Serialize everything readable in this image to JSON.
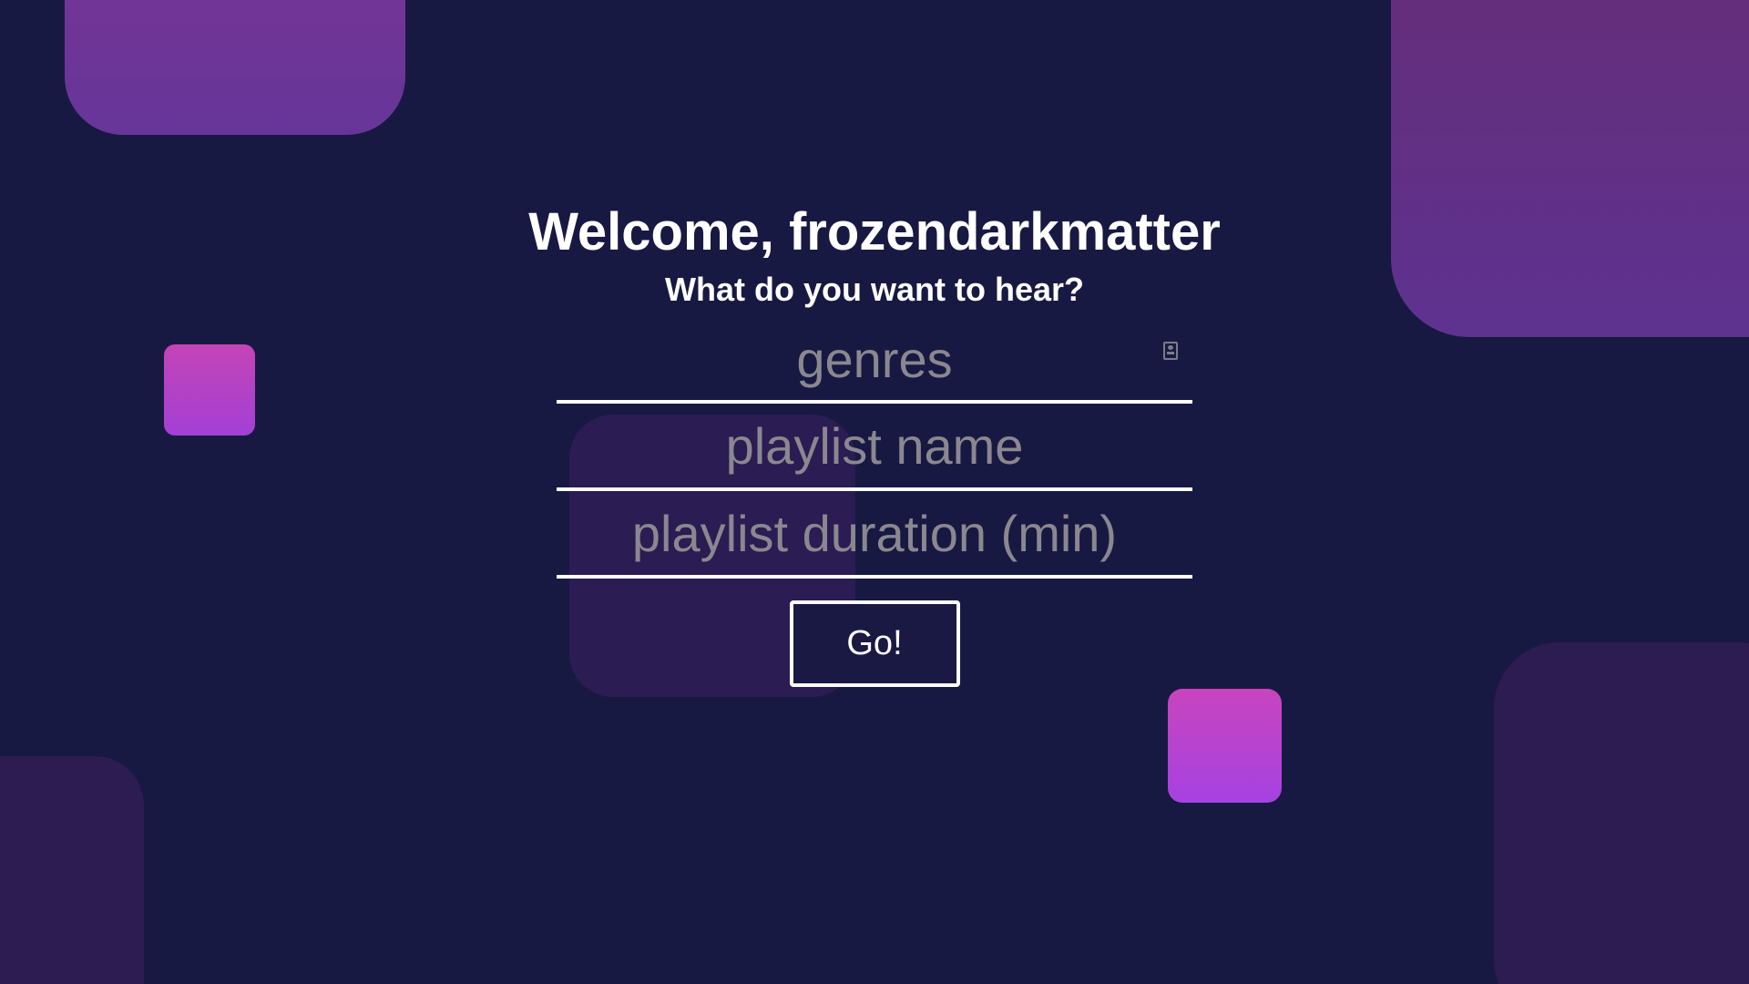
{
  "header": {
    "title": "Welcome, frozendarkmatter",
    "subtitle": "What do you want to hear?"
  },
  "form": {
    "fields": [
      {
        "placeholder": "genres",
        "value": "",
        "icon": "contact-card-icon"
      },
      {
        "placeholder": "playlist name",
        "value": ""
      },
      {
        "placeholder": "playlist duration (min)",
        "value": ""
      }
    ],
    "submit_label": "Go!"
  },
  "theme": {
    "background": "#181942",
    "accent_pink": "#c845bd",
    "accent_purple": "#a542e2",
    "text": "#ffffff",
    "placeholder": "#8a8790"
  }
}
